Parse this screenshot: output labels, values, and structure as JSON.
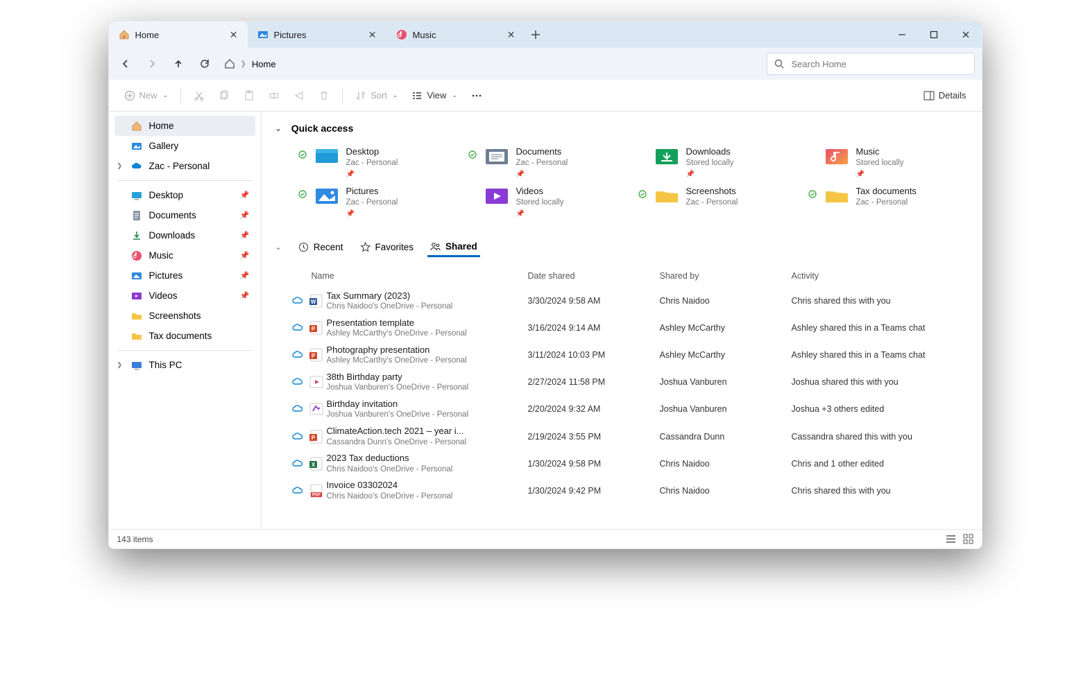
{
  "tabs": [
    {
      "label": "Home"
    },
    {
      "label": "Pictures"
    },
    {
      "label": "Music"
    }
  ],
  "breadcrumb": {
    "location": "Home"
  },
  "search": {
    "placeholder": "Search Home"
  },
  "toolbar": {
    "new": "New",
    "sort": "Sort",
    "view": "View",
    "details": "Details"
  },
  "sidebar": {
    "home": "Home",
    "gallery": "Gallery",
    "onedrive": "Zac - Personal",
    "pinned": [
      {
        "label": "Desktop"
      },
      {
        "label": "Documents"
      },
      {
        "label": "Downloads"
      },
      {
        "label": "Music"
      },
      {
        "label": "Pictures"
      },
      {
        "label": "Videos"
      },
      {
        "label": "Screenshots"
      },
      {
        "label": "Tax documents"
      }
    ],
    "thispc": "This PC"
  },
  "quickaccess": {
    "title": "Quick access",
    "items": [
      {
        "name": "Desktop",
        "sub": "Zac - Personal",
        "sync": true,
        "pin": true
      },
      {
        "name": "Documents",
        "sub": "Zac - Personal",
        "sync": true,
        "pin": true
      },
      {
        "name": "Downloads",
        "sub": "Stored locally",
        "sync": false,
        "pin": true
      },
      {
        "name": "Music",
        "sub": "Stored locally",
        "sync": false,
        "pin": true
      },
      {
        "name": "Pictures",
        "sub": "Zac - Personal",
        "sync": true,
        "pin": true
      },
      {
        "name": "Videos",
        "sub": "Stored locally",
        "sync": false,
        "pin": true
      },
      {
        "name": "Screenshots",
        "sub": "Zac - Personal",
        "sync": true,
        "pin": false
      },
      {
        "name": "Tax documents",
        "sub": "Zac - Personal",
        "sync": true,
        "pin": false
      }
    ]
  },
  "filters": {
    "recent": "Recent",
    "favorites": "Favorites",
    "shared": "Shared"
  },
  "columns": {
    "name": "Name",
    "date": "Date shared",
    "by": "Shared by",
    "activity": "Activity"
  },
  "files": [
    {
      "name": "Tax Summary (2023)",
      "sub": "Chris Naidoo's OneDrive - Personal",
      "date": "3/30/2024 9:58 AM",
      "by": "Chris Naidoo",
      "activity": "Chris shared this with you",
      "type": "word"
    },
    {
      "name": "Presentation template",
      "sub": "Ashley McCarthy's OneDrive - Personal",
      "date": "3/16/2024 9:14 AM",
      "by": "Ashley McCarthy",
      "activity": "Ashley shared this in a Teams chat",
      "type": "ppt"
    },
    {
      "name": "Photography presentation",
      "sub": "Ashley McCarthy's OneDrive - Personal",
      "date": "3/11/2024 10:03 PM",
      "by": "Ashley McCarthy",
      "activity": "Ashley shared this in a Teams chat",
      "type": "ppt"
    },
    {
      "name": "38th Birthday party",
      "sub": "Joshua Vanburen's OneDrive - Personal",
      "date": "2/27/2024 11:58 PM",
      "by": "Joshua Vanburen",
      "activity": "Joshua shared this with you",
      "type": "video"
    },
    {
      "name": "Birthday invitation",
      "sub": "Joshua Vanburen's OneDrive - Personal",
      "date": "2/20/2024 9:32 AM",
      "by": "Joshua Vanburen",
      "activity": "Joshua +3 others edited",
      "type": "design"
    },
    {
      "name": "ClimateAction.tech 2021 – year i...",
      "sub": "Cassandra Dunn's OneDrive - Personal",
      "date": "2/19/2024 3:55 PM",
      "by": "Cassandra Dunn",
      "activity": "Cassandra shared this with you",
      "type": "ppt"
    },
    {
      "name": "2023 Tax deductions",
      "sub": "Chris Naidoo's OneDrive - Personal",
      "date": "1/30/2024 9:58 PM",
      "by": "Chris Naidoo",
      "activity": "Chris and 1 other edited",
      "type": "excel"
    },
    {
      "name": "Invoice 03302024",
      "sub": "Chris Naidoo's OneDrive - Personal",
      "date": "1/30/2024 9:42 PM",
      "by": "Chris Naidoo",
      "activity": "Chris shared this with you",
      "type": "pdf"
    }
  ],
  "status": {
    "count": "143 items"
  }
}
